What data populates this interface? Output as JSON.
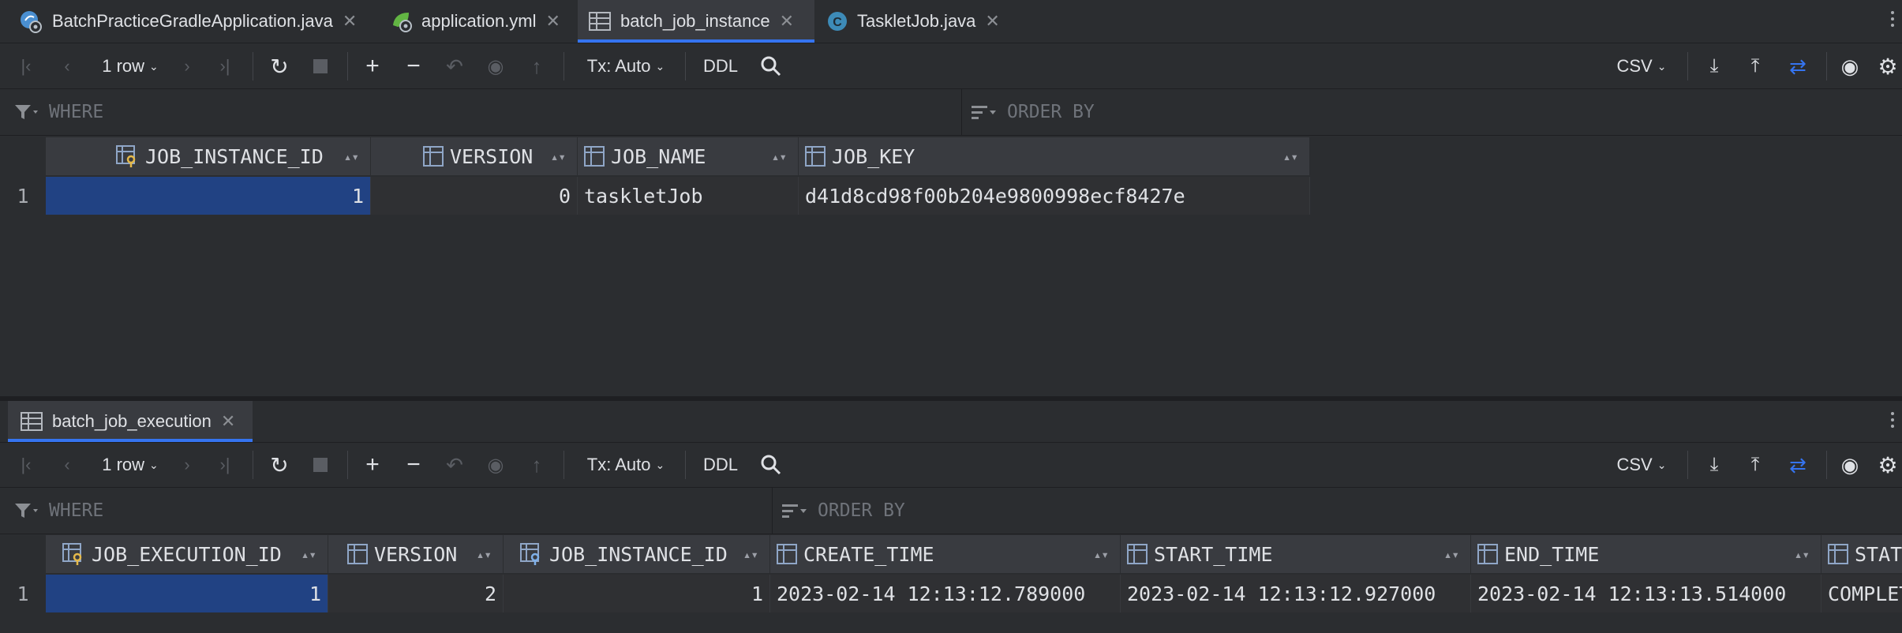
{
  "editor_tabs": [
    {
      "label": "BatchPracticeGradleApplication.java",
      "icon": "spring-app-icon",
      "active": false
    },
    {
      "label": "application.yml",
      "icon": "spring-config-icon",
      "active": false
    },
    {
      "label": "batch_job_instance",
      "icon": "table-icon",
      "active": true
    },
    {
      "label": "TaskletJob.java",
      "icon": "class-c-icon",
      "active": false
    }
  ],
  "close_glyph": "✕",
  "toolbar": {
    "rows_label": "1 row",
    "tx_label": "Tx: Auto",
    "ddl_label": "DDL",
    "export_format": "CSV"
  },
  "filters": {
    "where": "WHERE",
    "order_by": "ORDER BY"
  },
  "grid1": {
    "columns": [
      {
        "name": "JOB_INSTANCE_ID",
        "kind": "key"
      },
      {
        "name": "VERSION",
        "kind": "col"
      },
      {
        "name": "JOB_NAME",
        "kind": "col"
      },
      {
        "name": "JOB_KEY",
        "kind": "col"
      }
    ],
    "rows": [
      {
        "num": "1",
        "cells": [
          "1",
          "0",
          "taskletJob",
          "d41d8cd98f00b204e9800998ecf8427e"
        ]
      }
    ]
  },
  "results_tab": {
    "label": "batch_job_execution",
    "icon": "table-icon"
  },
  "grid2": {
    "columns": [
      {
        "name": "JOB_EXECUTION_ID",
        "kind": "key"
      },
      {
        "name": "VERSION",
        "kind": "col"
      },
      {
        "name": "JOB_INSTANCE_ID",
        "kind": "key"
      },
      {
        "name": "CREATE_TIME",
        "kind": "col"
      },
      {
        "name": "START_TIME",
        "kind": "col"
      },
      {
        "name": "END_TIME",
        "kind": "col"
      },
      {
        "name": "STATUS",
        "kind": "col"
      }
    ],
    "rows": [
      {
        "num": "1",
        "cells": [
          "1",
          "2",
          "1",
          "2023-02-14 12:13:12.789000",
          "2023-02-14 12:13:12.927000",
          "2023-02-14 12:13:13.514000",
          "COMPLETED"
        ]
      }
    ]
  },
  "colors": {
    "accent": "#3574f0",
    "selection": "#214283",
    "background": "#2b2d30"
  }
}
